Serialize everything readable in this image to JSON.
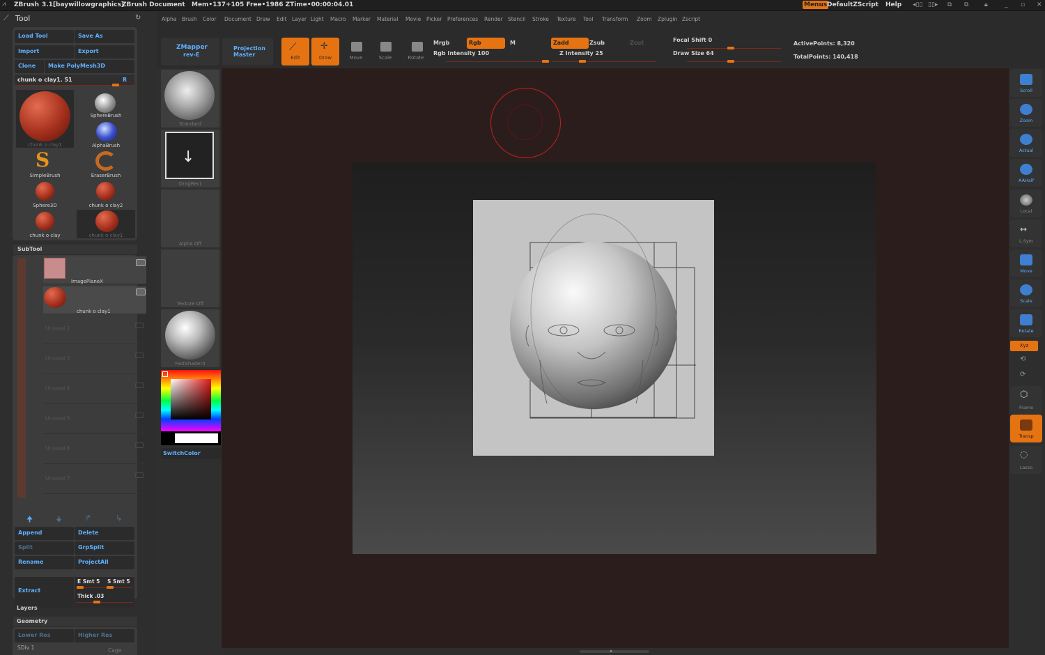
{
  "titlebar": {
    "app": "ZBrush",
    "version": "3.1[baywillowgraphics]",
    "doc": "ZBrush Document",
    "mem": "Mem•137+105 Free•1986 ZTime•00:00:04.01",
    "menus_btn": "Menus",
    "zscript": "DefaultZScript",
    "help": "Help"
  },
  "menus": [
    "Alpha",
    "Brush",
    "Color",
    "Document",
    "Draw",
    "Edit",
    "Layer",
    "Light",
    "Macro",
    "Marker",
    "Material",
    "Movie",
    "Picker",
    "Preferences",
    "Render",
    "Stencil",
    "Stroke",
    "Texture",
    "Tool",
    "Transform",
    "Zoom",
    "Zplugin",
    "Zscript"
  ],
  "tool": {
    "title": "Tool",
    "load": "Load Tool",
    "save": "Save As",
    "import": "Import",
    "export": "Export",
    "clone": "Clone",
    "make_poly": "Make PolyMesh3D",
    "current": "chunk o clay1. 51",
    "r_label": "R",
    "items": [
      "chunk o clay1",
      "SphereBrush",
      "AlphaBrush",
      "SimpleBrush",
      "EraserBrush",
      "Sphere3D",
      "chunk o clay2",
      "chunk o clay",
      "chunk o clay1"
    ]
  },
  "subtool": {
    "title": "SubTool",
    "slots": [
      "ImagePlaneX",
      "chunk o clay1"
    ],
    "unused": [
      "Unused 2",
      "Unused 3",
      "Unused 4",
      "Unused 5",
      "Unused 6",
      "Unused 7"
    ],
    "append": "Append",
    "delete": "Delete",
    "split": "Split",
    "grpsplit": "GrpSplit",
    "rename": "Rename",
    "projectall": "ProjectAll",
    "extract": "Extract",
    "esmt": "E Smt 5",
    "ssmt": "S Smt 5",
    "thick": "Thick .03"
  },
  "layers": "Layers",
  "geometry": {
    "title": "Geometry",
    "lower": "Lower Res",
    "higher": "Higher Res",
    "sdiv": "SDiv 1",
    "cage": "Cage"
  },
  "shelf": {
    "zmapper": "ZMapper",
    "zmapper_sub": "rev-E",
    "projection": "Projection",
    "projection_sub": "Master",
    "edit": "Edit",
    "draw": "Draw",
    "move": "Move",
    "scale": "Scale",
    "rotate": "Rotate",
    "mrgb": "Mrgb",
    "rgb": "Rgb",
    "m": "M",
    "rgb_intensity": "Rgb Intensity 100",
    "zadd": "Zadd",
    "zsub": "Zsub",
    "zcut": "Zcut",
    "z_intensity": "Z Intensity 25",
    "focal_shift": "Focal Shift 0",
    "draw_size": "Draw Size 64",
    "active_points": "ActivePoints: 8,320",
    "total_points": "TotalPoints: 140,418"
  },
  "lshelf": {
    "standard": "Standard",
    "dragrect": "DragRect",
    "alpha": "Alpha Off",
    "texture": "Texture Off",
    "material": "FastShader4",
    "switchcolor": "SwitchColor"
  },
  "rshelf": [
    "Scroll",
    "Zoom",
    "Actual",
    "AAHalf",
    "Local",
    "L.Sym",
    "Move",
    "Scale",
    "Rotate",
    "Xyz",
    "Frame",
    "Transp",
    "Lasso"
  ],
  "colors": {
    "accent": "#e67312",
    "blue": "#5fb0ff",
    "panel": "#3c3c3c",
    "canvas": "#2c1d1d"
  }
}
